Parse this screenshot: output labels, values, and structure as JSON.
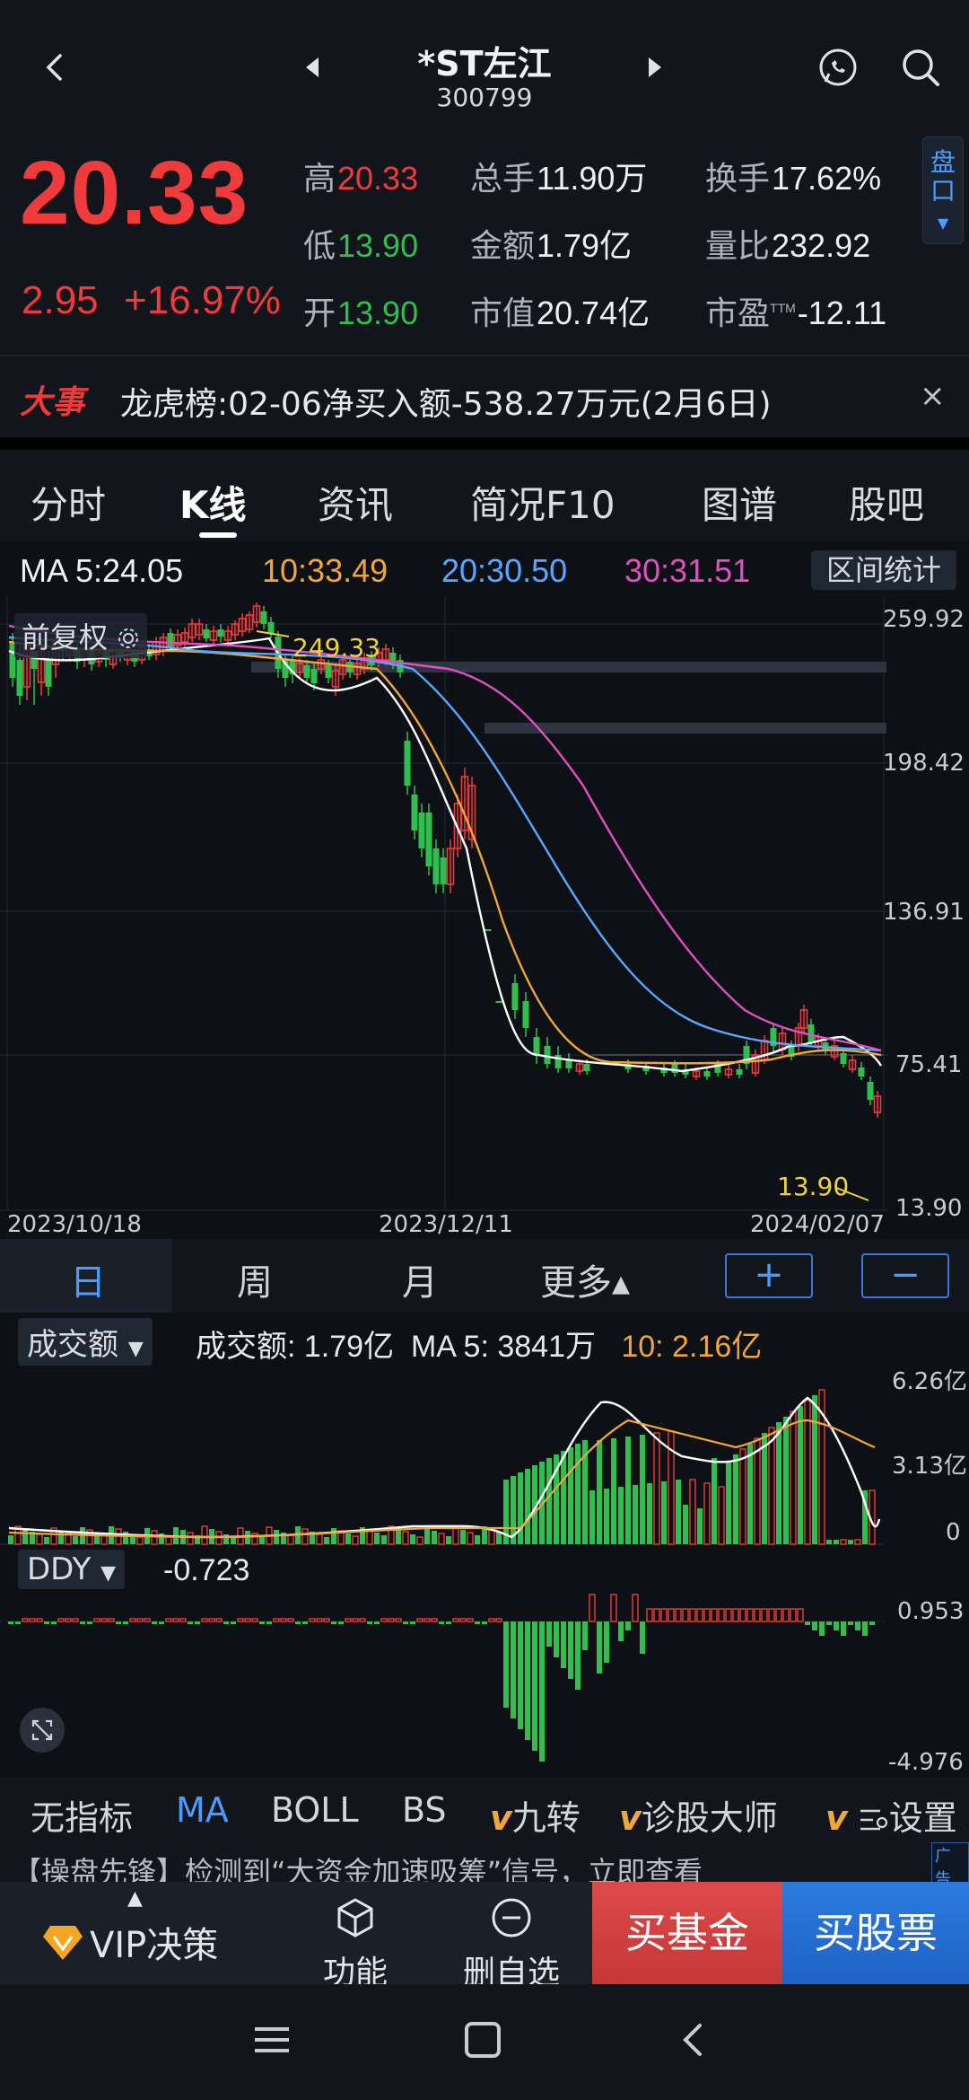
{
  "header": {
    "title": "*ST左江",
    "code": "300799"
  },
  "quote": {
    "price": "20.33",
    "change": "2.95",
    "change_pct": "+16.97%",
    "fields": {
      "high_label": "高",
      "high": "20.33",
      "low_label": "低",
      "low": "13.90",
      "open_label": "开",
      "open": "13.90",
      "volume_label": "总手",
      "volume": "11.90万",
      "amount_label": "金额",
      "amount": "1.79亿",
      "mktcap_label": "市值",
      "mktcap": "20.74亿",
      "turnover_label": "换手",
      "turnover": "17.62%",
      "volratio_label": "量比",
      "volratio": "232.92",
      "pe_label": "市盈",
      "pe_sup": "TTM",
      "pe": "-12.11"
    },
    "pankou": "盘口"
  },
  "news": {
    "tag": "大事",
    "text": "龙虎榜:02-06净买入额-538.27万元(2月6日)",
    "close": "×"
  },
  "tabs": [
    "分时",
    "K线",
    "资讯",
    "简况F10",
    "图谱",
    "股吧"
  ],
  "ma_row": {
    "ma5": "MA 5:24.05",
    "ma10": "10:33.49",
    "ma20": "20:30.50",
    "ma30": "30:31.51",
    "range_btn": "区间统计"
  },
  "kchart": {
    "adjust_label": "前复权",
    "price_labels": [
      "259.92",
      "198.42",
      "136.91",
      "75.41",
      "13.90"
    ],
    "high_mark": "249.33",
    "low_mark": "13.90",
    "dates": [
      "2023/10/18",
      "2023/12/11",
      "2024/02/07"
    ]
  },
  "periods": {
    "day": "日",
    "week": "周",
    "month": "月",
    "more": "更多▴",
    "plus": "+",
    "minus": "−"
  },
  "volume": {
    "selector": "成交额",
    "info_amount": "成交额: 1.79亿",
    "info_ma5": "MA 5: 3841万",
    "info_ma10": "10: 2.16亿",
    "axis": [
      "6.26亿",
      "3.13亿",
      "0"
    ]
  },
  "ddy": {
    "selector": "DDY",
    "value": "-0.723",
    "axis": [
      "0.953",
      "-4.976"
    ]
  },
  "indicators": [
    "无指标",
    "MA",
    "BOLL",
    "BS",
    "九转",
    "诊股大师",
    "设置"
  ],
  "ad": {
    "text": "【操盘先锋】检测到“大资金加速吸筹”信号，立即查看",
    "badge": "广告"
  },
  "bottom": {
    "vip": "VIP决策",
    "func": "功能",
    "remove": "删自选",
    "buy_fund": "买基金",
    "buy_stock": "买股票"
  },
  "colors": {
    "up": "#ef3b3b",
    "down": "#2fbf4f",
    "ma10": "#f0a63a",
    "ma20": "#58a8ff",
    "ma30": "#e050c0",
    "accent": "#4a9cff"
  }
}
